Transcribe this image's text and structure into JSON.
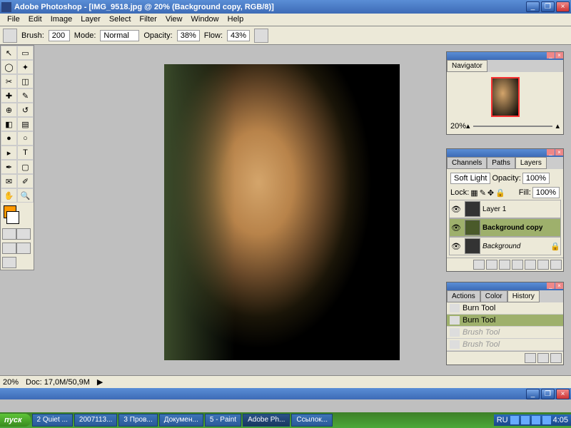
{
  "title": "Adobe Photoshop - [IMG_9518.jpg @ 20% (Background copy, RGB/8)]",
  "menu": [
    "File",
    "Edit",
    "Image",
    "Layer",
    "Select",
    "Filter",
    "View",
    "Window",
    "Help"
  ],
  "options": {
    "brush_label": "Brush:",
    "brush_size": "200",
    "mode_label": "Mode:",
    "mode_value": "Normal",
    "opacity_label": "Opacity:",
    "opacity_value": "38%",
    "flow_label": "Flow:",
    "flow_value": "43%"
  },
  "status": {
    "zoom": "20%",
    "doc": "Doc: 17,0M/50,9M"
  },
  "navigator": {
    "tab": "Navigator",
    "zoom": "20%"
  },
  "layers": {
    "tabs": [
      "Channels",
      "Paths",
      "Layers"
    ],
    "blend": "Soft Light",
    "opacity_label": "Opacity:",
    "opacity": "100%",
    "lock_label": "Lock:",
    "fill_label": "Fill:",
    "fill": "100%",
    "items": [
      {
        "name": "Layer 1",
        "sel": false,
        "locked": false
      },
      {
        "name": "Background copy",
        "sel": true,
        "locked": false
      },
      {
        "name": "Background",
        "sel": false,
        "locked": true
      }
    ]
  },
  "history": {
    "tabs": [
      "Actions",
      "Color",
      "History"
    ],
    "items": [
      {
        "name": "Burn Tool",
        "sel": false,
        "faded": false
      },
      {
        "name": "Burn Tool",
        "sel": true,
        "faded": false
      },
      {
        "name": "Brush Tool",
        "sel": false,
        "faded": true
      },
      {
        "name": "Brush Tool",
        "sel": false,
        "faded": true
      }
    ]
  },
  "taskbar": {
    "start": "пуск",
    "tasks": [
      "2 Quiet ...",
      "2007113...",
      "3 Пров...",
      "Докумен...",
      "5 - Paint",
      "Adobe Ph...",
      "Ссылок..."
    ],
    "lang": "RU",
    "time": "4:05"
  }
}
